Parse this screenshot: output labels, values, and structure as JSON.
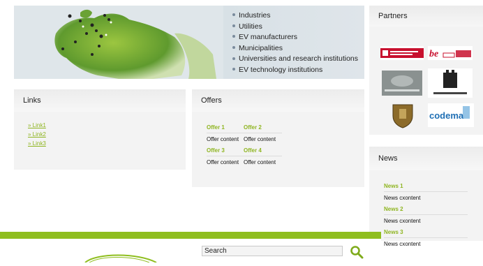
{
  "banner": {
    "audiences": [
      "Industries",
      "Utilities",
      "EV manufacturers",
      "Municipalities",
      "Universities and research institutions",
      "EV technology institutions"
    ]
  },
  "links": {
    "title": "Links",
    "items": [
      "» Link1",
      "» Link2",
      "» Link3"
    ]
  },
  "offers": {
    "title": "Offers",
    "rows": [
      {
        "a_title": "Offer 1",
        "b_title": "Offer 2",
        "a_content": "Offer content",
        "b_content": "Offer content"
      },
      {
        "a_title": "Offer 3",
        "b_title": "Offer 4",
        "a_content": "Offer content",
        "b_content": "Offer content"
      }
    ]
  },
  "partners": {
    "title": "Partners",
    "logos": [
      "barcelona-logo",
      "berlin-logo",
      "bornholm-logo",
      "copenhagen-logo",
      "coat-of-arms-logo",
      "codema-logo"
    ]
  },
  "news": {
    "title": "News",
    "items": [
      {
        "title": "News 1",
        "content": "News cxontent"
      },
      {
        "title": "News 2",
        "content": "News cxontent"
      },
      {
        "title": "News 3",
        "content": "News cxontent"
      }
    ]
  },
  "footer": {
    "search_label": "Search"
  },
  "colors": {
    "accent_green": "#8fbe1f",
    "link_green": "#8fb521",
    "panel_bg": "#f3f3f3"
  }
}
